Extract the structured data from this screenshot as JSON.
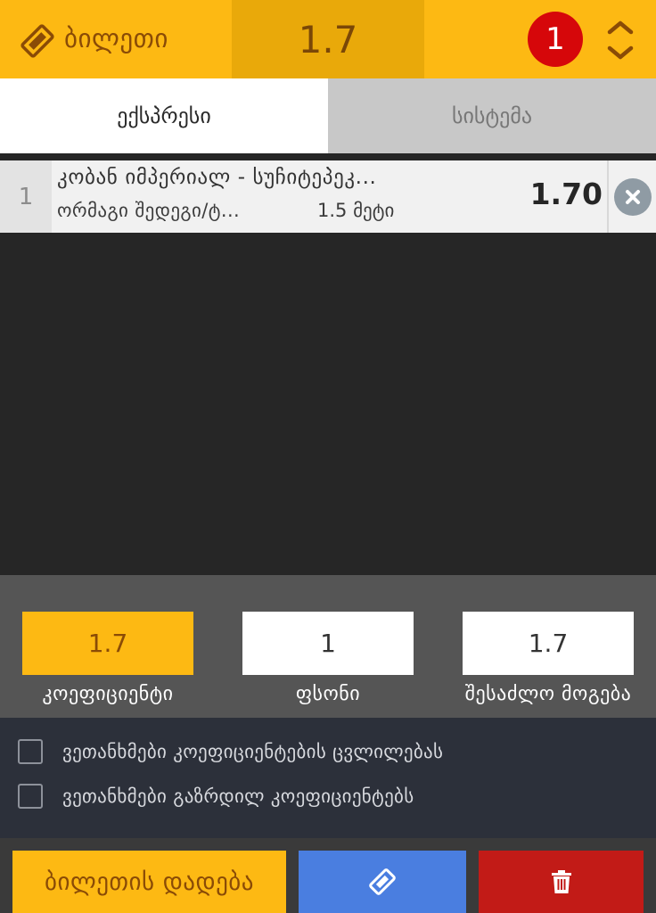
{
  "header": {
    "ticket_label": "ბილეთი",
    "total_odds": "1.7",
    "bet_count": "1"
  },
  "tabs": [
    {
      "label": "ექსპრესი",
      "active": true
    },
    {
      "label": "სისტემა",
      "active": false
    }
  ],
  "bets": [
    {
      "index": "1",
      "match": "კობან იმპერიალ - სუჩიტეპეკ...",
      "market": "ორმაგი შედეგი/ტ...",
      "selection": "1.5 მეტი",
      "odd": "1.70"
    }
  ],
  "summary": {
    "coefficient_value": "1.7",
    "coefficient_label": "კოეფიციენტი",
    "stake_value": "1",
    "stake_label": "ფსონი",
    "win_value": "1.7",
    "win_label": "შესაძლო მოგება"
  },
  "options": [
    {
      "label": "ვეთანხმები კოეფიციენტების ცვლილებას",
      "checked": false
    },
    {
      "label": "ვეთანხმები გაზრდილ კოეფიციენტებს",
      "checked": false
    }
  ],
  "actions": {
    "place_label": "ბილეთის დადება"
  },
  "icons": {
    "ticket": "ticket-icon",
    "toggle": "chevron-up-down-icon",
    "remove": "close-icon",
    "save": "ticket-icon",
    "delete": "trash-icon"
  },
  "colors": {
    "accent": "#FDB913",
    "badge": "#d6070a",
    "save_button": "#4a7ee0",
    "delete_button": "#c21b17"
  }
}
